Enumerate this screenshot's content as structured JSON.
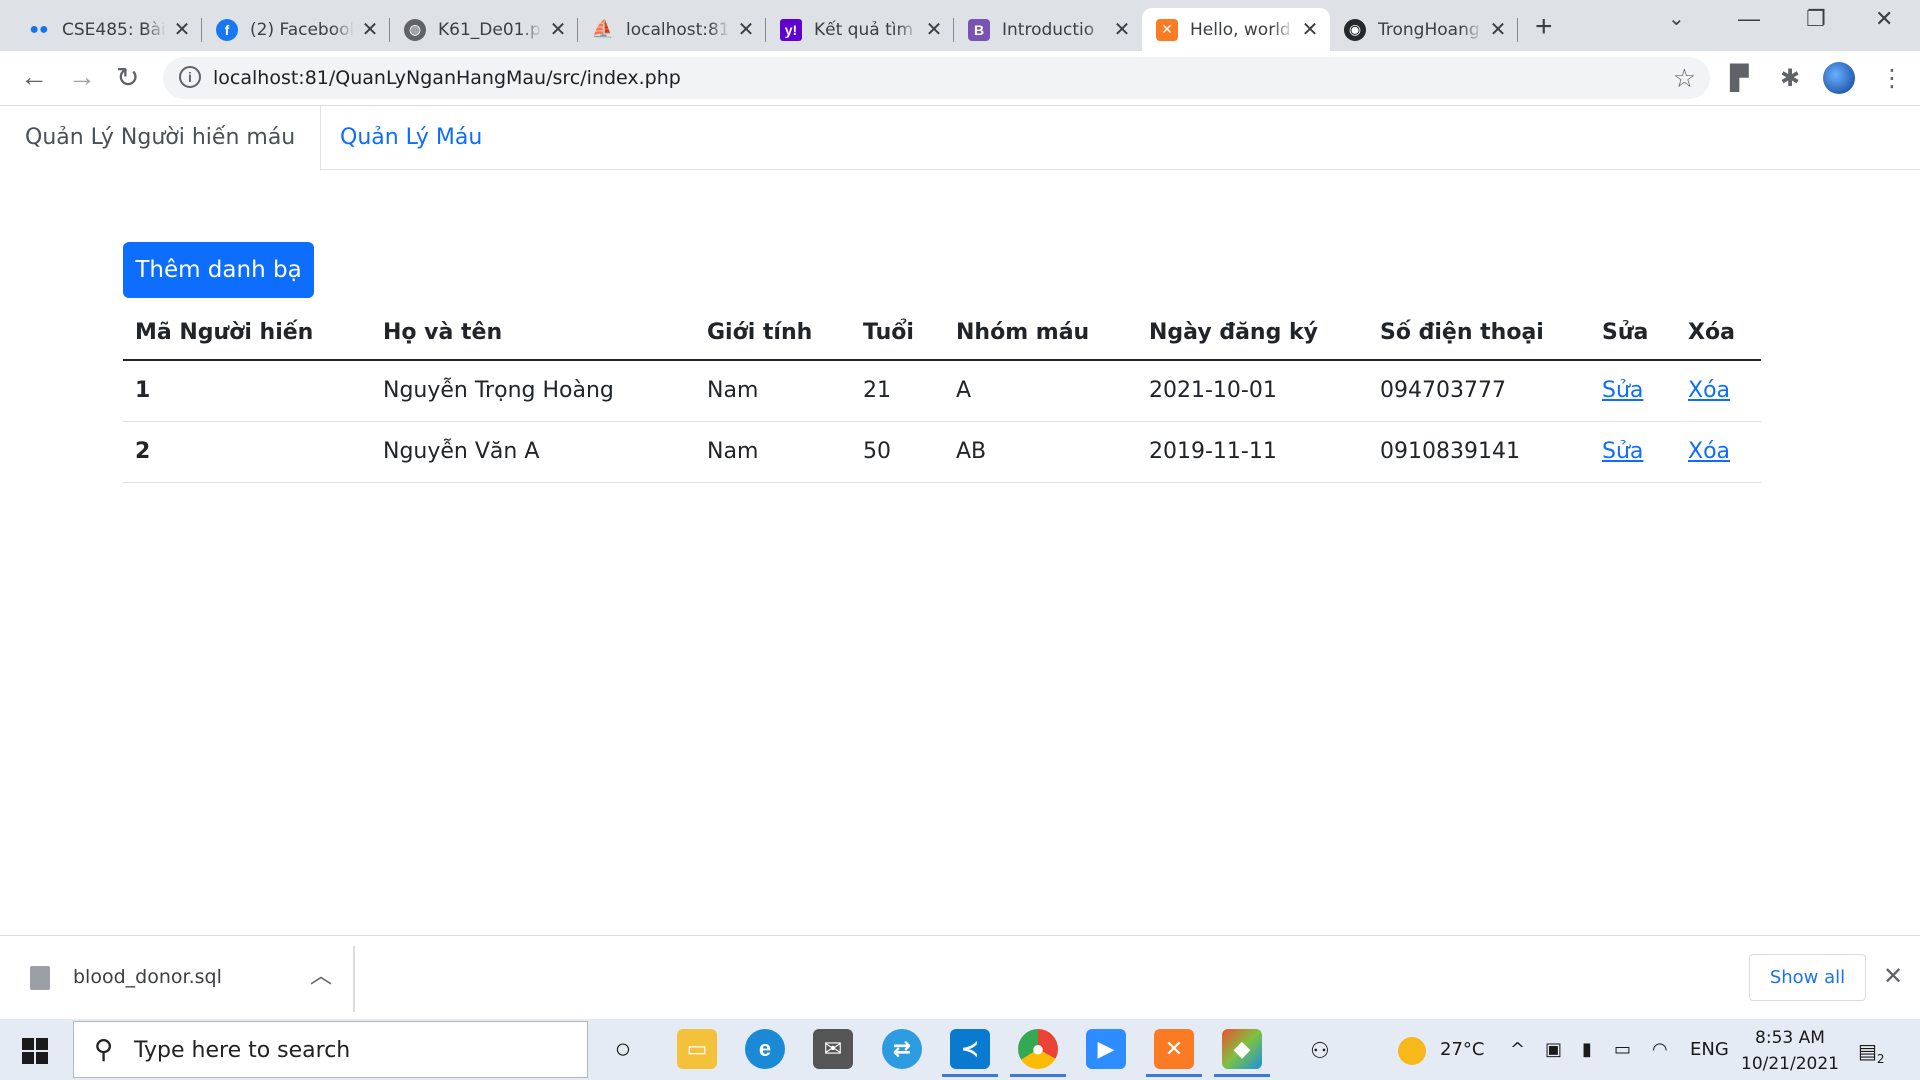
{
  "browser": {
    "tabs": [
      {
        "title": "CSE485: Bài",
        "icon": "dots-icon",
        "color": "#1a73e8"
      },
      {
        "title": "(2) Facebook",
        "icon": "facebook-icon",
        "color": "#1877f2"
      },
      {
        "title": "K61_De01.p",
        "icon": "globe-icon",
        "color": "#5f6368"
      },
      {
        "title": "localhost:81",
        "icon": "phpmyadmin-icon",
        "color": "#f29111"
      },
      {
        "title": "Kết quả tìm",
        "icon": "yahoo-icon",
        "color": "#6001d2"
      },
      {
        "title": "Introductio",
        "icon": "bootstrap-icon",
        "color": "#7952b3"
      },
      {
        "title": "Hello, world",
        "icon": "xampp-icon",
        "color": "#fb7a24"
      },
      {
        "title": "TrongHoang",
        "icon": "github-icon",
        "color": "#24292e"
      }
    ],
    "active_tab_index": 6,
    "url": "localhost:81/QuanLyNganHangMau/src/index.php"
  },
  "page": {
    "nav_tabs": [
      "Quản Lý Người hiến máu",
      "Quản Lý Máu"
    ],
    "add_button": "Thêm danh bạ",
    "table": {
      "headers": [
        "Mã Người hiến",
        "Họ và tên",
        "Giới tính",
        "Tuổi",
        "Nhóm máu",
        "Ngày đăng ký",
        "Số điện thoại",
        "Sửa",
        "Xóa"
      ],
      "rows": [
        {
          "id": "1",
          "name": "Nguyễn Trọng Hoàng",
          "gender": "Nam",
          "age": "21",
          "blood": "A",
          "date": "2021-10-01",
          "phone": "094703777",
          "edit": "Sửa",
          "delete": "Xóa"
        },
        {
          "id": "2",
          "name": "Nguyễn Văn A",
          "gender": "Nam",
          "age": "50",
          "blood": "AB",
          "date": "2019-11-11",
          "phone": "0910839141",
          "edit": "Sửa",
          "delete": "Xóa"
        }
      ]
    }
  },
  "downloads": {
    "file": "blood_donor.sql",
    "show_all": "Show all"
  },
  "taskbar": {
    "search_placeholder": "Type here to search",
    "temperature": "27°C",
    "language": "ENG",
    "time": "8:53 AM",
    "date": "10/21/2021",
    "notifications": "2"
  }
}
